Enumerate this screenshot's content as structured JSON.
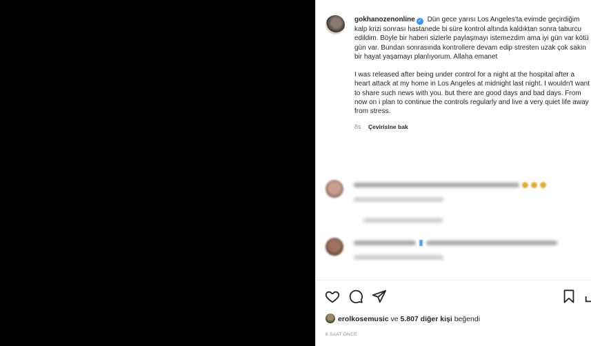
{
  "post": {
    "username": "gokhanozenonline",
    "caption_tr": "Dün gece yarısı Los Angeles'ta evimde geçirdiğim kalp krizi sonrası hastanede bi süre kontrol altında kaldıktan sonra taburcu edildim. Böyle bir haberi sizlerle paylaşmayı istemezdim ama iyi gün var kötü gün var. Bundan sonrasında kontrollere devam edip stresten uzak çok sakin bir hayat yaşamayı planlıyorum. Allaha emanet",
    "caption_en": "I was released after being under control for a night at the hospital after a heart attack at my home in Los Angeles at midnight last night. I wouldn't want to share such news with you. but there are good days and bad days. From now on i plan to continue the controls regularly and live a very quiet life away from stress.",
    "age": "8s",
    "translate_label": "Çevirisine bak"
  },
  "likes": {
    "liker": "erolkosemusic",
    "connector": "ve",
    "others": "5.807 diğer kişi",
    "suffix": "beğendi"
  },
  "timestamp": "8 SAAT ÖNCE",
  "icons": [
    "heart-icon",
    "comment-icon",
    "share-icon",
    "bookmark-icon",
    "verified-icon"
  ],
  "colors": {
    "verified": "#3897f0",
    "text": "#262626",
    "muted": "#8e8e8e"
  }
}
